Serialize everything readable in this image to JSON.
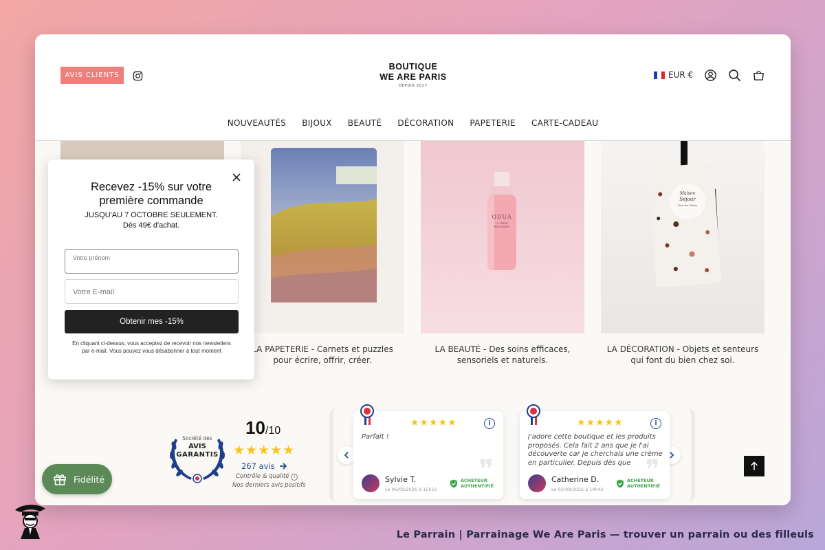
{
  "header": {
    "avis_label": "AVIS CLIENTS",
    "logo_line1": "BOUTIQUE",
    "logo_line2": "WE ARE PARIS",
    "logo_line3": "DEPUIS 2017",
    "currency": "EUR €",
    "nav": [
      "NOUVEAUTÉS",
      "BIJOUX",
      "BEAUTÉ",
      "DÉCORATION",
      "PAPETERIE",
      "CARTE-CADEAU"
    ]
  },
  "products": [
    {
      "caption_line1": "LA PAPETERIE - Carnets et puzzles",
      "caption_line2": "pour écrire, offrir, créer."
    },
    {
      "caption_line1": "LA BEAUTÉ - Des soins efficaces,",
      "caption_line2": "sensoriels et naturels.",
      "bottle_brand": "ODUA",
      "bottle_sub1": "LA CRÈME",
      "bottle_sub2": "REPULPANTE"
    },
    {
      "caption_line1": "LA DÉCORATION - Objets et senteurs",
      "caption_line2": "qui font du bien chez soi.",
      "label1": "Maison",
      "label2": "Séjour",
      "label3": "Rose des Sables"
    }
  ],
  "popup": {
    "title_line1": "Recevez -15% sur votre",
    "title_line2": "première commande",
    "sub1": "JUSQU'AU 7 OCTOBRE SEULEMENT.",
    "sub2": "Dès 49€ d'achat.",
    "firstname_label": "Votre prénom",
    "email_placeholder": "Votre E-mail",
    "submit_label": "Obtenir mes -15%",
    "legal": "En cliquant ci-dessus, vous acceptez de recevoir nos newsletters par e-mail. Vous pouvez vous désabonner à tout moment"
  },
  "reviews": {
    "badge_line1": "Société des",
    "badge_line2": "AVIS",
    "badge_line3": "GARANTIS",
    "score": "10",
    "score_max": "/10",
    "stars": "★★★★★",
    "count": "267 avis",
    "control": "Contrôle & qualité",
    "last": "Nos derniers avis positifs",
    "verified_line1": "ACHETEUR",
    "verified_line2": "AUTHENTIFIÉ",
    "items": [
      {
        "text": "Parfait !",
        "name": "Sylvie T.",
        "date": "Le 06/09/2026 à 15h16"
      },
      {
        "text": "J'adore cette boutique et les produits proposés. Cela fait 2 ans que je l'ai découverte car je cherchais une crème en particulier. Depuis dès que",
        "name": "Catherine D.",
        "date": "Le 02/09/2026 à 14h42"
      }
    ]
  },
  "fidelite": {
    "label": "Fidélité"
  },
  "footer": {
    "text": "Le Parrain | Parrainage We Are Paris — trouver un parrain ou des filleuls"
  },
  "colors": {
    "accent": "#f07e7b",
    "button_dark": "#222222",
    "review_blue": "#1f4e8c",
    "star": "#f5c518",
    "fidelite_green": "#5b8a57"
  }
}
